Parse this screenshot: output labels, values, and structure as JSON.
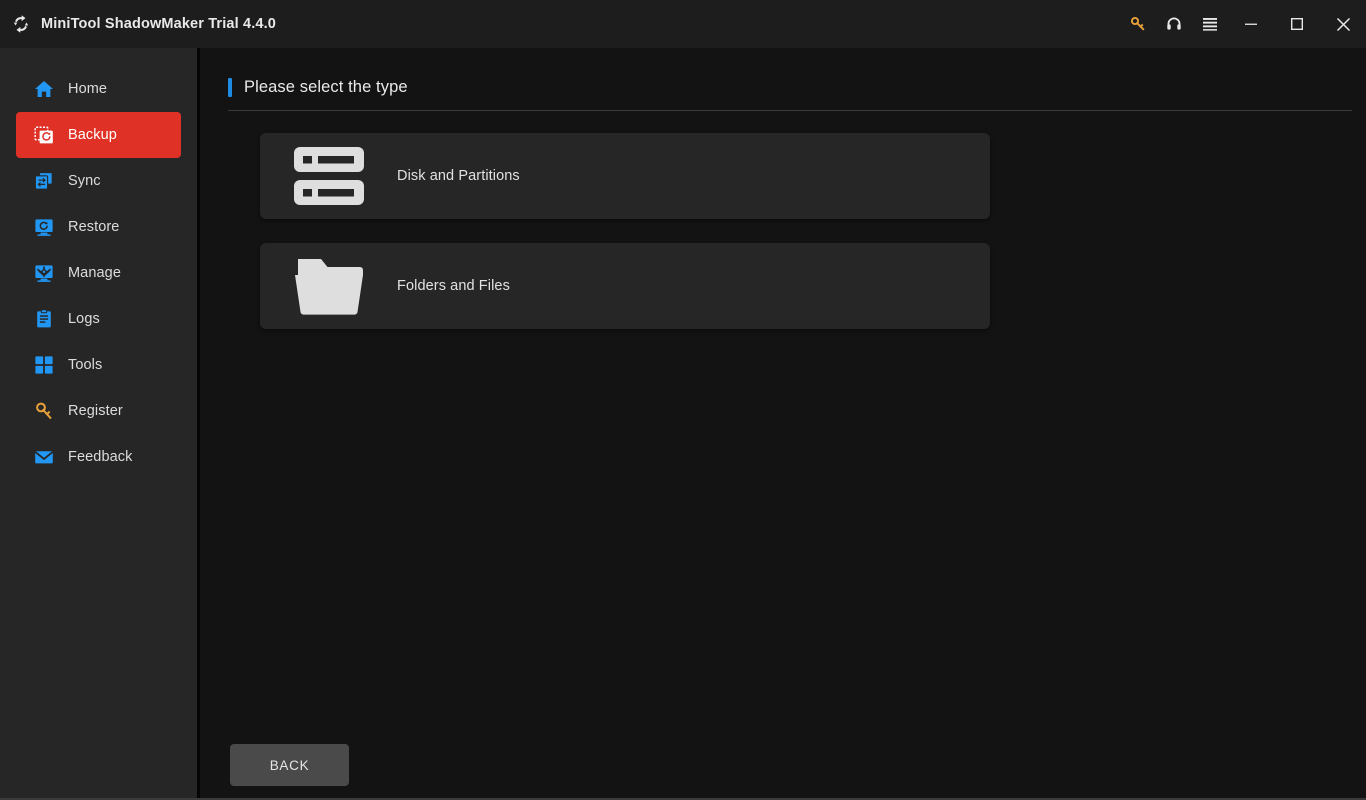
{
  "window": {
    "title": "MiniTool ShadowMaker Trial 4.4.0",
    "logo_icon": "refresh-arrows-logo",
    "controls": [
      {
        "name": "key-icon",
        "label": "Register",
        "color": "#e8a13a"
      },
      {
        "name": "headset-icon",
        "label": "Support",
        "color": "#e8e8e8"
      },
      {
        "name": "hamburger-menu-icon",
        "label": "Menu",
        "color": "#e8e8e8"
      },
      {
        "name": "minimize-icon",
        "label": "Minimize",
        "color": "#e8e8e8"
      },
      {
        "name": "maximize-icon",
        "label": "Maximize",
        "color": "#e8e8e8"
      },
      {
        "name": "close-icon",
        "label": "Close",
        "color": "#e8e8e8"
      }
    ]
  },
  "sidebar": {
    "items": [
      {
        "label": "Home",
        "icon": "home-icon",
        "active": false
      },
      {
        "label": "Backup",
        "icon": "backup-icon",
        "active": true
      },
      {
        "label": "Sync",
        "icon": "sync-icon",
        "active": false
      },
      {
        "label": "Restore",
        "icon": "restore-icon",
        "active": false
      },
      {
        "label": "Manage",
        "icon": "manage-icon",
        "active": false
      },
      {
        "label": "Logs",
        "icon": "logs-icon",
        "active": false
      },
      {
        "label": "Tools",
        "icon": "tools-icon",
        "active": false
      }
    ],
    "bottom_items": [
      {
        "label": "Register",
        "icon": "key-icon",
        "active": false
      },
      {
        "label": "Feedback",
        "icon": "envelope-icon",
        "active": false
      }
    ]
  },
  "main": {
    "page_title": "Please select the type",
    "cards": [
      {
        "label": "Disk and Partitions",
        "icon": "disk-partitions-icon"
      },
      {
        "label": "Folders and Files",
        "icon": "folder-icon"
      }
    ],
    "back_label": "BACK"
  },
  "colors": {
    "accent_blue": "#1e8ae0",
    "active_red": "#e03127",
    "icon_blue": "#2196f3",
    "key_orange": "#e8a13a",
    "titlebar_bg": "#1d1d1d",
    "sidebar_bg": "#262626",
    "content_bg": "#131313",
    "card_bg": "#262626",
    "button_bg": "#4a4a4a"
  }
}
